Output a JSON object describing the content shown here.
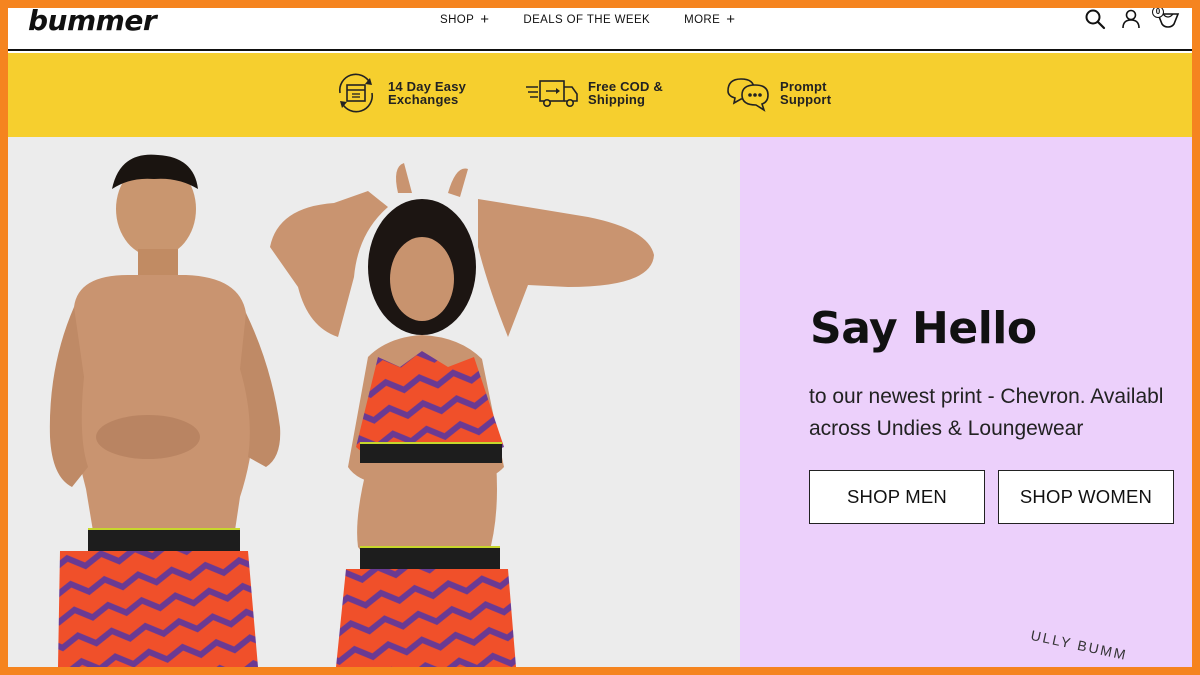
{
  "header": {
    "logo": "bummer",
    "nav": [
      {
        "label": "SHOP",
        "has_plus": true
      },
      {
        "label": "DEALS OF THE WEEK",
        "has_plus": false
      },
      {
        "label": "MORE",
        "has_plus": true
      }
    ],
    "plus_symbol": "+",
    "cart_count": "0",
    "icons": [
      "search-icon",
      "account-icon",
      "cart-icon"
    ]
  },
  "perks": [
    {
      "line1": "14 Day Easy",
      "line2": "Exchanges",
      "icon": "exchange-box-icon"
    },
    {
      "line1": "Free COD &",
      "line2": "Shipping",
      "icon": "delivery-truck-icon"
    },
    {
      "line1": "Prompt",
      "line2": "Support",
      "icon": "chat-bubbles-icon"
    }
  ],
  "hero": {
    "headline": "Say Hello",
    "sub_line1": "to our newest print - Chevron. Availabl",
    "sub_line2": "across Undies & Loungewear",
    "btn_men": "SHOP MEN",
    "btn_women": "SHOP WOMEN",
    "stamp_text": "ULLY BUMM"
  },
  "colors": {
    "page_border": "#f5841f",
    "perks_bar": "#f6cf2e",
    "hero_right_bg": "#ecd0fb",
    "hero_left_bg": "#ececec",
    "chevron_orange": "#f0502a",
    "chevron_purple": "#6a3a93"
  }
}
